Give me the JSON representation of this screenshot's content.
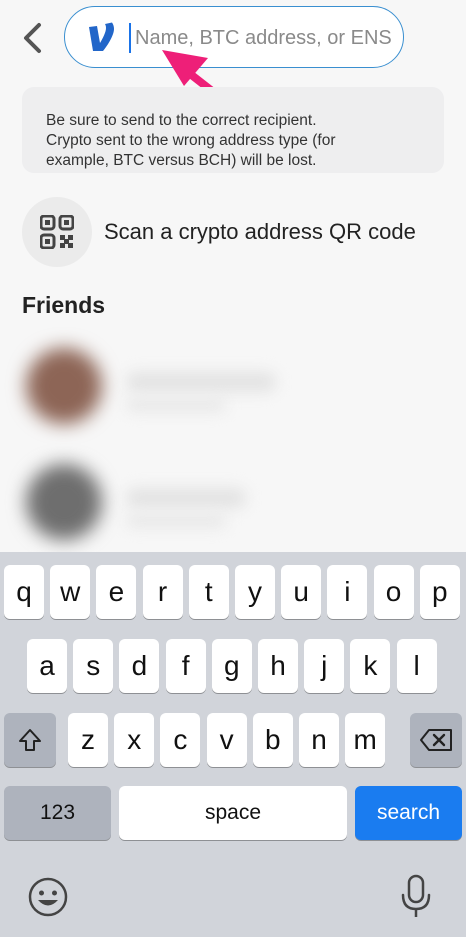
{
  "search": {
    "placeholder": "Name, BTC address, or ENS",
    "value": ""
  },
  "notice": {
    "line1": "Be sure to send to the correct recipient.",
    "line2": "Crypto sent to the wrong address type (for",
    "line3": "example, BTC versus BCH) will be lost."
  },
  "scan": {
    "label": "Scan a crypto address QR code"
  },
  "friends": {
    "title": "Friends"
  },
  "keyboard": {
    "row1": [
      "q",
      "w",
      "e",
      "r",
      "t",
      "y",
      "u",
      "i",
      "o",
      "p"
    ],
    "row2": [
      "a",
      "s",
      "d",
      "f",
      "g",
      "h",
      "j",
      "k",
      "l"
    ],
    "row3": [
      "z",
      "x",
      "c",
      "v",
      "b",
      "n",
      "m"
    ],
    "numbers_label": "123",
    "space_label": "space",
    "search_label": "search"
  },
  "colors": {
    "accent": "#1a7cf0",
    "venmo_blue": "#2266c9",
    "arrow_pink": "#ee1f78"
  }
}
